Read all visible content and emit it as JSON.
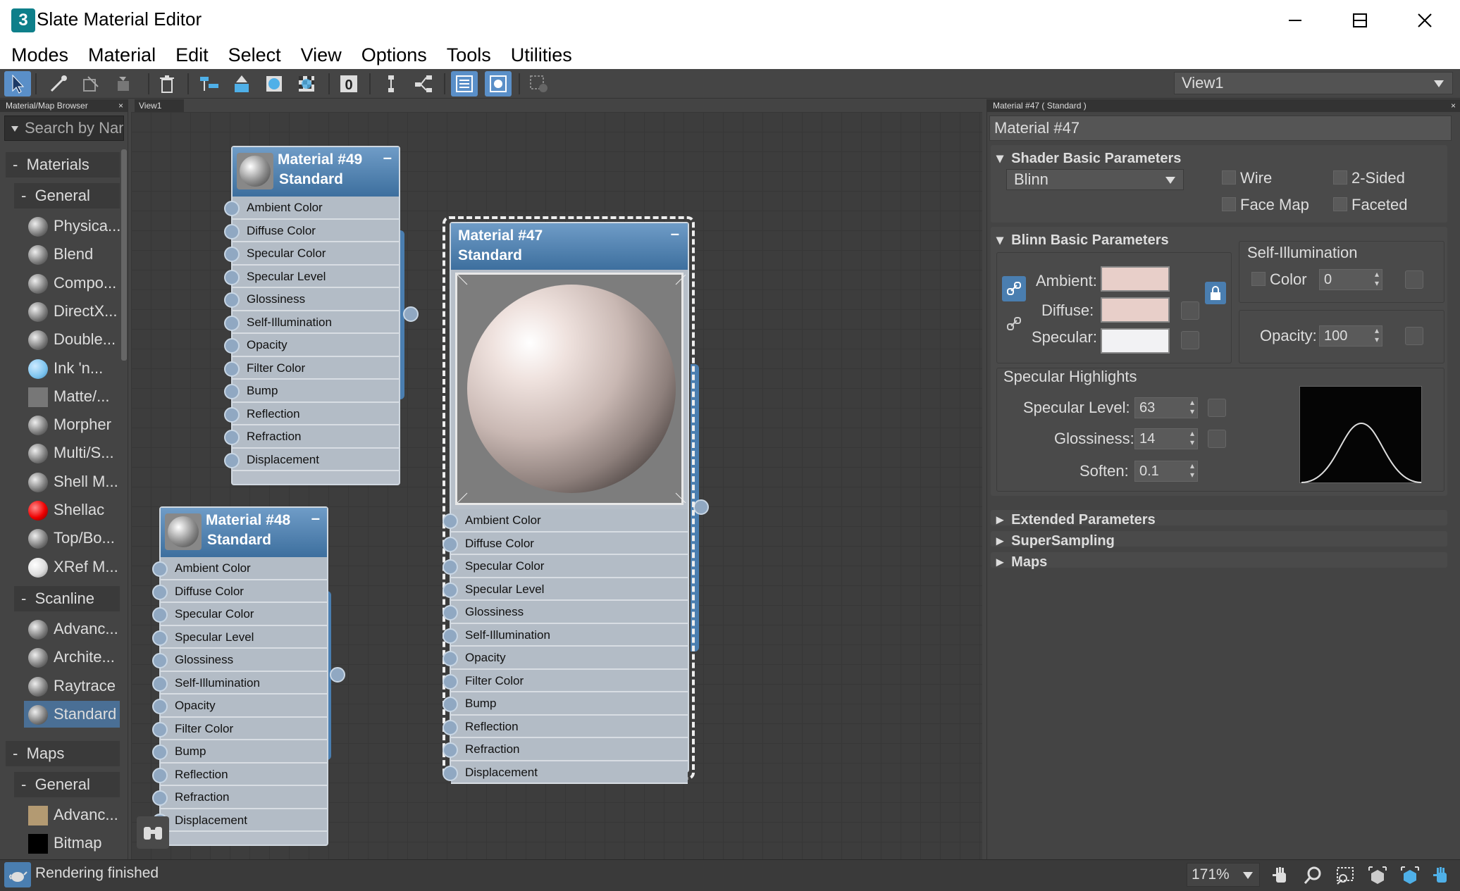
{
  "window": {
    "title": "Slate Material Editor",
    "app_icon": "3"
  },
  "menu": [
    "Modes",
    "Material",
    "Edit",
    "Select",
    "View",
    "Options",
    "Tools",
    "Utilities"
  ],
  "toolbar": {
    "view_selector": "View1"
  },
  "browser": {
    "title": "Material/Map Browser",
    "search_placeholder": "Search by Name ...",
    "materials_label": "Materials",
    "general_label": "General",
    "general_items": [
      {
        "label": "Physica...",
        "swatch": "sphere"
      },
      {
        "label": "Blend",
        "swatch": "sphere"
      },
      {
        "label": "Compo...",
        "swatch": "sphere"
      },
      {
        "label": "DirectX...",
        "swatch": "sphere"
      },
      {
        "label": "Double...",
        "swatch": "sphere"
      },
      {
        "label": "Ink 'n...",
        "swatch": "light-blue"
      },
      {
        "label": "Matte/...",
        "swatch": "gray-square"
      },
      {
        "label": "Morpher",
        "swatch": "sphere"
      },
      {
        "label": "Multi/S...",
        "swatch": "sphere"
      },
      {
        "label": "Shell M...",
        "swatch": "sphere"
      },
      {
        "label": "Shellac",
        "swatch": "red"
      },
      {
        "label": "Top/Bo...",
        "swatch": "sphere"
      },
      {
        "label": "XRef M...",
        "swatch": "white"
      }
    ],
    "scanline_label": "Scanline",
    "scanline_items": [
      "Advanc...",
      "Archite...",
      "Raytrace",
      "Standard"
    ],
    "selected_item": "Standard",
    "maps_label": "Maps",
    "maps_general_label": "General",
    "maps_items": [
      {
        "label": "Advanc...",
        "swatch": "tan"
      },
      {
        "label": "Bitmap",
        "swatch": "black"
      }
    ]
  },
  "view": {
    "tab": "View1"
  },
  "slots": [
    "Ambient Color",
    "Diffuse Color",
    "Specular Color",
    "Specular Level",
    "Glossiness",
    "Self-Illumination",
    "Opacity",
    "Filter Color",
    "Bump",
    "Reflection",
    "Refraction",
    "Displacement"
  ],
  "nodes": {
    "m49": {
      "name": "Material #49",
      "type": "Standard"
    },
    "m48": {
      "name": "Material #48",
      "type": "Standard"
    },
    "m47": {
      "name": "Material #47",
      "type": "Standard"
    }
  },
  "params": {
    "header": "Material #47  ( Standard )",
    "name": "Material #47",
    "shader_section": "Shader Basic Parameters",
    "shader": "Blinn",
    "wire": "Wire",
    "two_sided": "2-Sided",
    "face_map": "Face Map",
    "faceted": "Faceted",
    "blinn_section": "Blinn Basic Parameters",
    "ambient": "Ambient:",
    "diffuse": "Diffuse:",
    "specular": "Specular:",
    "ambient_color": "#e8cfc9",
    "diffuse_color": "#e8cfc9",
    "specular_color": "#f2f2f4",
    "self_illum": "Self-Illumination",
    "color": "Color",
    "color_value": "0",
    "opacity": "Opacity:",
    "opacity_value": "100",
    "spec_highlights": "Specular Highlights",
    "spec_level": "Specular Level:",
    "spec_level_value": "63",
    "glossiness": "Glossiness:",
    "glossiness_value": "14",
    "soften": "Soften:",
    "soften_value": "0.1",
    "extended": "Extended Parameters",
    "supersampling": "SuperSampling",
    "maps": "Maps"
  },
  "status": {
    "text": "Rendering finished",
    "zoom": "171%"
  }
}
